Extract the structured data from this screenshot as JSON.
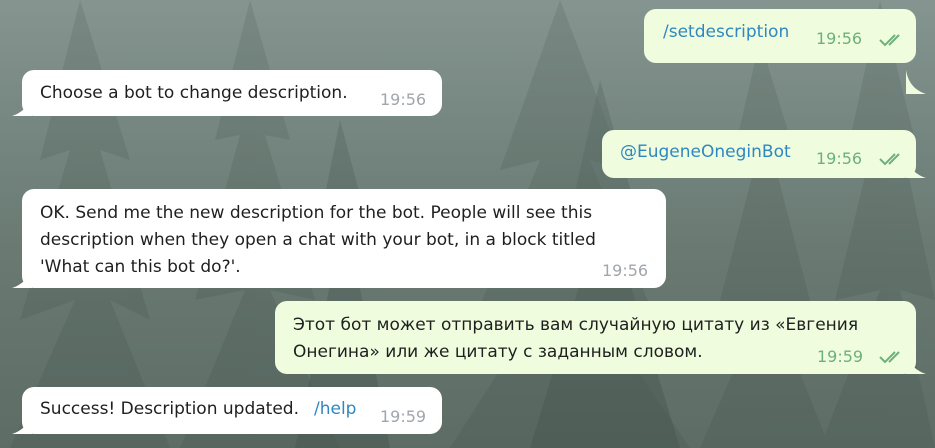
{
  "chat": {
    "messages": [
      {
        "direction": "out",
        "text": "/setdescription",
        "is_command": true,
        "time": "19:56",
        "status": "read"
      },
      {
        "direction": "in",
        "text": "Choose a bot to change description.",
        "time": "19:56"
      },
      {
        "direction": "out",
        "text": "@EugeneOneginBot",
        "is_mention": true,
        "time": "19:56",
        "status": "read"
      },
      {
        "direction": "in",
        "text": "OK. Send me the new description for the bot. People will see this\ndescription when they open a chat with your bot, in a block titled\n'What can this bot do?'.",
        "time": "19:56"
      },
      {
        "direction": "out",
        "text": "Этот бот может отправить вам случайную цитату из «Евгения\nОнегина» или же цитату с заданным словом.",
        "time": "19:59",
        "status": "read"
      },
      {
        "direction": "in",
        "text": "Success! Description updated.",
        "command": "/help",
        "time": "19:59"
      }
    ]
  },
  "colors": {
    "incoming_bubble": "#ffffff",
    "outgoing_bubble": "#effdde",
    "link": "#2f87c2",
    "outgoing_time": "#6db07b",
    "incoming_time": "#a0a6ab"
  },
  "icons": {
    "read_status": "double-check-icon"
  }
}
